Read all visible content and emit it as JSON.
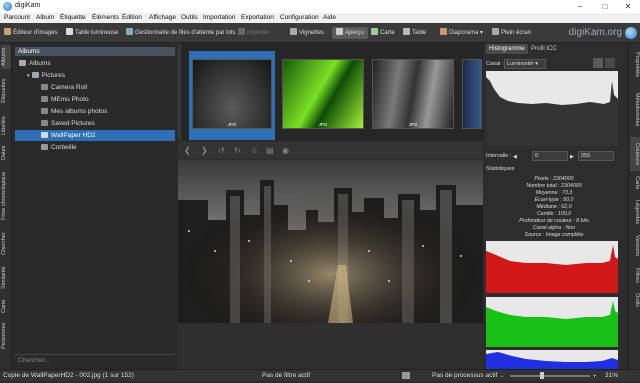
{
  "window": {
    "title": "digiKam"
  },
  "menu": [
    "Parcourir",
    "Album",
    "Étiquette",
    "Éléments",
    "Édition",
    "Affichage",
    "Outils",
    "Importation",
    "Exportation",
    "Configuration",
    "Aide"
  ],
  "toolbar": {
    "editor": "Éditeur d'images",
    "lighttable": "Table lumineuse",
    "queue": "Gestionnaire de files d'attente par lots",
    "import": "Importer",
    "thumbs": "Vignettes",
    "preview": "Aperçu",
    "map": "Carte",
    "table": "Table",
    "slideshow": "Diaporama",
    "fullscreen": "Plein écran",
    "brand": "digiKam.org"
  },
  "left_tabs": [
    "Albums",
    "Étiquettes",
    "Libellés",
    "Dates",
    "Frise chronologique",
    "Chercher",
    "Similarité",
    "Carte",
    "Personnes"
  ],
  "albums": {
    "header": "Albums",
    "tree": [
      "Albums",
      "Pictures",
      "Camera Roll",
      "MEmu Photo",
      "Mes albums photos",
      "Saved Pictures",
      "WallPaper HD2",
      "Corbeille"
    ],
    "search_placeholder": "Chercher..."
  },
  "thumbs": [
    "JPG",
    "JPG",
    "JPG"
  ],
  "right": {
    "tab_histogram": "Histogramme",
    "tab_icc": "Profil ICC",
    "channel_label": "Canal :",
    "channel_value": "Luminosité",
    "interval_label": "Intervalle :",
    "interval_min": "0",
    "interval_max": "255",
    "stats_title": "Statistiques",
    "stats": [
      "Pixels : 2304000",
      "Nombre total : 2304000",
      "Moyenne : 73,3",
      "Écart-type : 50,0",
      "Médiane : 62,0",
      "Centile : 100,0",
      "Profondeur de couleur : 8 bits",
      "Canal alpha : Non",
      "Source : Image complète"
    ]
  },
  "right_tabs": [
    "Propriétés",
    "Métadonnées",
    "Couleurs",
    "Carte",
    "Légendes",
    "Versions",
    "Filtres",
    "Outils"
  ],
  "status": {
    "left": "Copie de WallPaperHD2 - 002.jpg (1 sur 152)",
    "filter": "Pas de filtre actif",
    "process": "Pas de processus actif",
    "zoom": "31%"
  },
  "colors": {
    "selection": "#2f6fb6",
    "red": "#d01818",
    "green": "#18c018",
    "blue": "#2030e0"
  }
}
